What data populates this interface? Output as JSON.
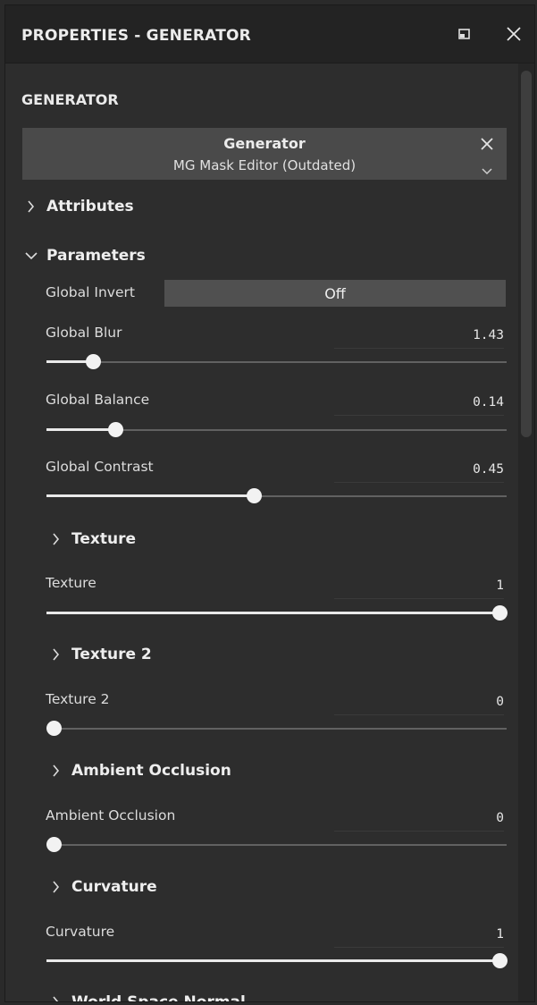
{
  "window": {
    "title": "PROPERTIES - GENERATOR",
    "icons": {
      "undock": "undock-icon",
      "close": "close-icon"
    }
  },
  "section": {
    "title": "GENERATOR"
  },
  "generator": {
    "title": "Generator",
    "subtitle": "MG Mask Editor (Outdated)",
    "icons": {
      "remove": "close-icon",
      "dropdown": "chevron-down-icon"
    }
  },
  "groups": {
    "attributes": {
      "label": "Attributes",
      "expanded": false
    },
    "parameters": {
      "label": "Parameters",
      "expanded": true
    }
  },
  "params": {
    "global_invert": {
      "label": "Global Invert",
      "value": "Off"
    },
    "global_blur": {
      "label": "Global Blur",
      "value": "1.43",
      "level": 0.1
    },
    "global_balance": {
      "label": "Global Balance",
      "value": "0.14",
      "level": 0.15
    },
    "global_contrast": {
      "label": "Global Contrast",
      "value": "0.45",
      "level": 0.45
    }
  },
  "subgroups": {
    "texture": {
      "header": "Texture",
      "label": "Texture",
      "value": "1",
      "level": 1.0
    },
    "texture2": {
      "header": "Texture 2",
      "label": "Texture 2",
      "value": "0",
      "level": 0.0
    },
    "ambient_occlusion": {
      "header": "Ambient Occlusion",
      "label": "Ambient Occlusion",
      "value": "0",
      "level": 0.0
    },
    "curvature": {
      "header": "Curvature",
      "label": "Curvature",
      "value": "1",
      "level": 1.0
    },
    "world_space_normal": {
      "header": "World Space Normal"
    }
  },
  "colors": {
    "panel_bg": "#2d2d2d",
    "titlebar_bg": "#232323",
    "generator_box": "#4a4a4a",
    "toggle_bg": "#505050",
    "slider_track": "#616161",
    "slider_fill": "#e9e9e9"
  }
}
